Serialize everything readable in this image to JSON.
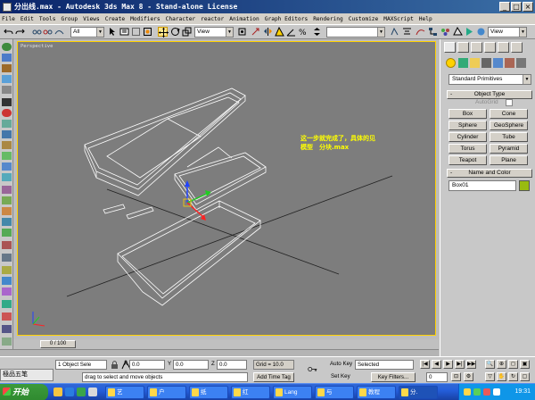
{
  "window": {
    "title": "分出线.max - Autodesk 3ds Max 8 - Stand-alone License",
    "minimize_glyph": "_",
    "maximize_glyph": "□",
    "close_glyph": "×"
  },
  "menu": [
    "File",
    "Edit",
    "Tools",
    "Group",
    "Views",
    "Create",
    "Modifiers",
    "Character",
    "reactor",
    "Animation",
    "Graph Editors",
    "Rendering",
    "Customize",
    "MAXScript",
    "Help"
  ],
  "toolbar": {
    "selection_filter": "All",
    "reference_coord": "View",
    "named_selection": "",
    "render_view": "View"
  },
  "viewport": {
    "label": "Perspective",
    "annotation_line1": "这一步就完成了，具体的见",
    "annotation_line2": "模型　分块.max"
  },
  "panel": {
    "category": "Standard Primitives",
    "object_type_title": "Object Type",
    "autogrid_label": "AutoGrid",
    "buttons": [
      "Box",
      "Cone",
      "Sphere",
      "GeoSphere",
      "Cylinder",
      "Tube",
      "Torus",
      "Pyramid",
      "Teapot",
      "Plane"
    ],
    "name_color_title": "Name and Color",
    "object_name": "Box01",
    "object_color": "#99bb11",
    "collapse_glyph": "-"
  },
  "timeline": {
    "frame": "0 / 100"
  },
  "status": {
    "selected": "1 Object Sele",
    "x_label": "X",
    "x_value": "0.0",
    "y_label": "Y",
    "y_value": "0.0",
    "z_label": "Z",
    "z_value": "0.0",
    "grid": "Grid = 10.0",
    "auto_key": "Auto Key",
    "key_mode": "Selected",
    "set_key": "Set Key",
    "key_filters": "Key Filters...",
    "prompt": "drag to select and move objects",
    "add_time_tag": "Add Time Tag",
    "frame_field": "0"
  },
  "ime": {
    "label": "極品五笔"
  },
  "taskbar": {
    "start": "开始",
    "tasks": [
      "艺",
      "户",
      "纸",
      "红",
      "Lang",
      "与",
      "教程",
      "分."
    ],
    "clock": "19:31"
  },
  "colors": {
    "viewport_bg": "#7d7d7d",
    "viewport_border": "#ffd200",
    "annotation": "#ffff00",
    "wireframe": "#ffffff"
  }
}
